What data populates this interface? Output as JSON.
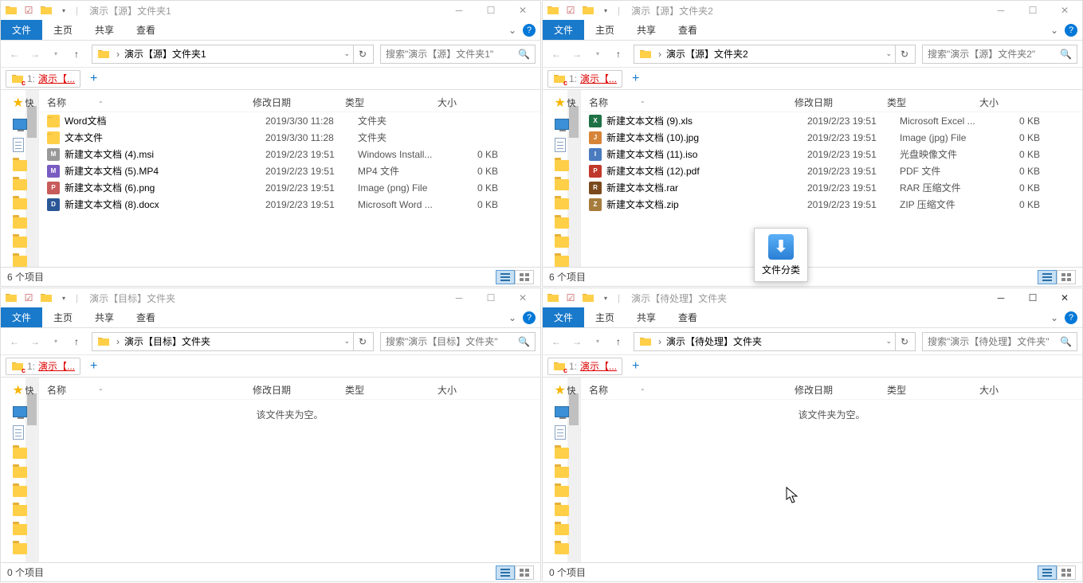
{
  "windows": [
    {
      "title": "演示【源】文件夹1",
      "ribbon": {
        "file": "文件",
        "tabs": [
          "主页",
          "共享",
          "查看"
        ]
      },
      "breadcrumb": "演示【源】文件夹1",
      "search_placeholder": "搜索\"演示【源】文件夹1\"",
      "tab": {
        "num": "1:",
        "label": "演示【..."
      },
      "cols": {
        "name": "名称",
        "date": "修改日期",
        "type": "类型",
        "size": "大小"
      },
      "files": [
        {
          "name": "Word文档",
          "date": "2019/3/30 11:28",
          "type": "文件夹",
          "size": "",
          "icon": "folder"
        },
        {
          "name": "文本文件",
          "date": "2019/3/30 11:28",
          "type": "文件夹",
          "size": "",
          "icon": "folder"
        },
        {
          "name": "新建文本文档 (4).msi",
          "date": "2019/2/23 19:51",
          "type": "Windows Install...",
          "size": "0 KB",
          "icon": "msi"
        },
        {
          "name": "新建文本文档 (5).MP4",
          "date": "2019/2/23 19:51",
          "type": "MP4 文件",
          "size": "0 KB",
          "icon": "mp4"
        },
        {
          "name": "新建文本文档 (6).png",
          "date": "2019/2/23 19:51",
          "type": "Image (png) File",
          "size": "0 KB",
          "icon": "png"
        },
        {
          "name": "新建文本文档 (8).docx",
          "date": "2019/2/23 19:51",
          "type": "Microsoft Word ...",
          "size": "0 KB",
          "icon": "docx"
        }
      ],
      "empty": "",
      "status": "6 个项目"
    },
    {
      "title": "演示【源】文件夹2",
      "ribbon": {
        "file": "文件",
        "tabs": [
          "主页",
          "共享",
          "查看"
        ]
      },
      "breadcrumb": "演示【源】文件夹2",
      "search_placeholder": "搜索\"演示【源】文件夹2\"",
      "tab": {
        "num": "1:",
        "label": "演示【..."
      },
      "cols": {
        "name": "名称",
        "date": "修改日期",
        "type": "类型",
        "size": "大小"
      },
      "files": [
        {
          "name": "新建文本文档 (9).xls",
          "date": "2019/2/23 19:51",
          "type": "Microsoft Excel ...",
          "size": "0 KB",
          "icon": "xls"
        },
        {
          "name": "新建文本文档 (10).jpg",
          "date": "2019/2/23 19:51",
          "type": "Image (jpg) File",
          "size": "0 KB",
          "icon": "jpg"
        },
        {
          "name": "新建文本文档 (11).iso",
          "date": "2019/2/23 19:51",
          "type": "光盘映像文件",
          "size": "0 KB",
          "icon": "iso"
        },
        {
          "name": "新建文本文档 (12).pdf",
          "date": "2019/2/23 19:51",
          "type": "PDF 文件",
          "size": "0 KB",
          "icon": "pdf"
        },
        {
          "name": "新建文本文档.rar",
          "date": "2019/2/23 19:51",
          "type": "RAR 压缩文件",
          "size": "0 KB",
          "icon": "rar"
        },
        {
          "name": "新建文本文档.zip",
          "date": "2019/2/23 19:51",
          "type": "ZIP 压缩文件",
          "size": "0 KB",
          "icon": "zip"
        }
      ],
      "empty": "",
      "status": "6 个项目"
    },
    {
      "title": "演示【目标】文件夹",
      "ribbon": {
        "file": "文件",
        "tabs": [
          "主页",
          "共享",
          "查看"
        ]
      },
      "breadcrumb": "演示【目标】文件夹",
      "search_placeholder": "搜索\"演示【目标】文件夹\"",
      "tab": {
        "num": "1:",
        "label": "演示【..."
      },
      "cols": {
        "name": "名称",
        "date": "修改日期",
        "type": "类型",
        "size": "大小"
      },
      "files": [],
      "empty": "该文件夹为空。",
      "status": "0 个项目"
    },
    {
      "title": "演示【待处理】文件夹",
      "ribbon": {
        "file": "文件",
        "tabs": [
          "主页",
          "共享",
          "查看"
        ]
      },
      "breadcrumb": "演示【待处理】文件夹",
      "search_placeholder": "搜索\"演示【待处理】文件夹\"",
      "tab": {
        "num": "1:",
        "label": "演示【..."
      },
      "cols": {
        "name": "名称",
        "date": "修改日期",
        "type": "类型",
        "size": "大小"
      },
      "files": [],
      "empty": "该文件夹为空。",
      "status": "0 个项目",
      "onedrive": "C"
    }
  ],
  "overlay": {
    "label": "文件分类"
  },
  "quick_label": "快"
}
